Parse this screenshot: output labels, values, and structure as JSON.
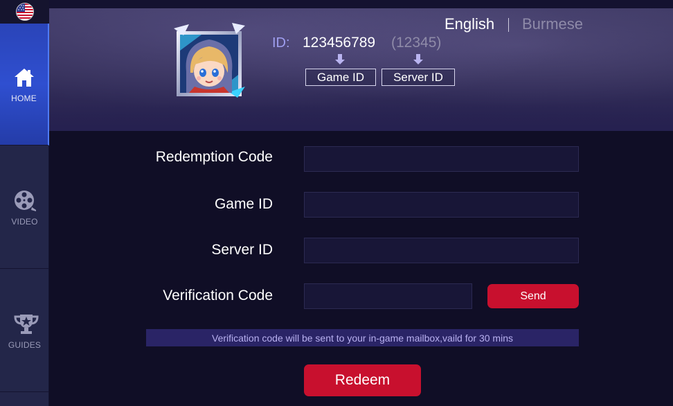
{
  "sidebar": {
    "flag_icon": "us-flag-icon",
    "items": [
      {
        "label": "HOME",
        "icon": "home-icon",
        "active": true
      },
      {
        "label": "VIDEO",
        "icon": "film-reel-icon",
        "active": false
      },
      {
        "label": "GUIDES",
        "icon": "trophy-icon",
        "active": false
      }
    ]
  },
  "header": {
    "languages": [
      "English",
      "Burmese"
    ],
    "active_language": "English",
    "avatar_icon": "hero-avatar-icon",
    "id_prefix": "ID:",
    "id_value": "123456789",
    "id_server": "(12345)",
    "id_labels": [
      "Game ID",
      "Server ID"
    ]
  },
  "form": {
    "fields": [
      {
        "label": "Redemption Code",
        "value": "",
        "placeholder": ""
      },
      {
        "label": "Game ID",
        "value": "",
        "placeholder": ""
      },
      {
        "label": "Server ID",
        "value": "",
        "placeholder": ""
      },
      {
        "label": "Verification Code",
        "value": "",
        "placeholder": ""
      }
    ],
    "send_label": "Send",
    "notice": "Verification code will be sent to your in-game mailbox,vaild for 30 mins",
    "redeem_label": "Redeem"
  },
  "colors": {
    "accent_red": "#c8102e",
    "sidebar_active": "#2f4fd0",
    "id_prefix": "#9f9ff0",
    "notice_bg": "#2a2466"
  }
}
